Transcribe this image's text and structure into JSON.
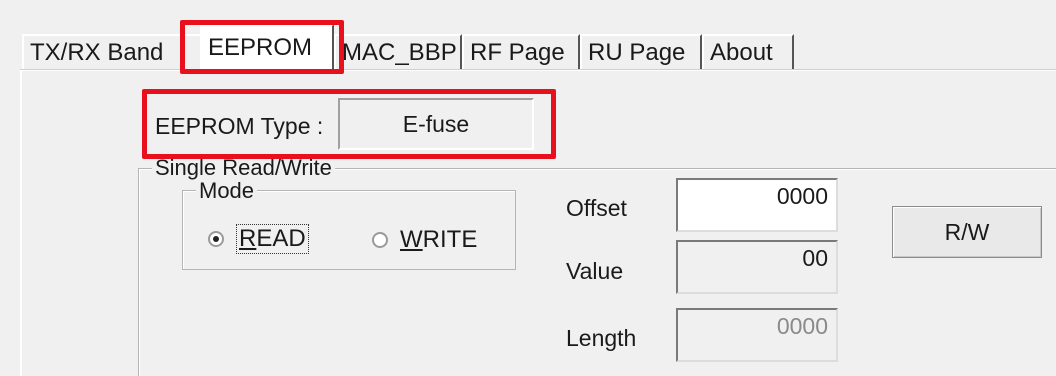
{
  "tabs": [
    {
      "label": "TX/RX Band",
      "active": false
    },
    {
      "label": "EEPROM",
      "active": true
    },
    {
      "label": "MAC_BBP",
      "active": false
    },
    {
      "label": "RF Page",
      "active": false
    },
    {
      "label": "RU Page",
      "active": false
    },
    {
      "label": "About",
      "active": false
    }
  ],
  "eeprom_type": {
    "label": "EEPROM Type :",
    "value": "E-fuse"
  },
  "single_rw": {
    "group_title": "Single Read/Write",
    "mode": {
      "group_title": "Mode",
      "read_label_u": "R",
      "read_label_rest": "EAD",
      "write_label_u": "W",
      "write_label_rest": "RITE",
      "selected": "READ"
    },
    "offset": {
      "label": "Offset",
      "value": "0000"
    },
    "value": {
      "label": "Value",
      "value": "00"
    },
    "length": {
      "label": "Length",
      "value": "0000"
    },
    "rw_button": "R/W"
  },
  "colors": {
    "highlight": "#e8101c",
    "window_bg": "#f0f0f0"
  }
}
